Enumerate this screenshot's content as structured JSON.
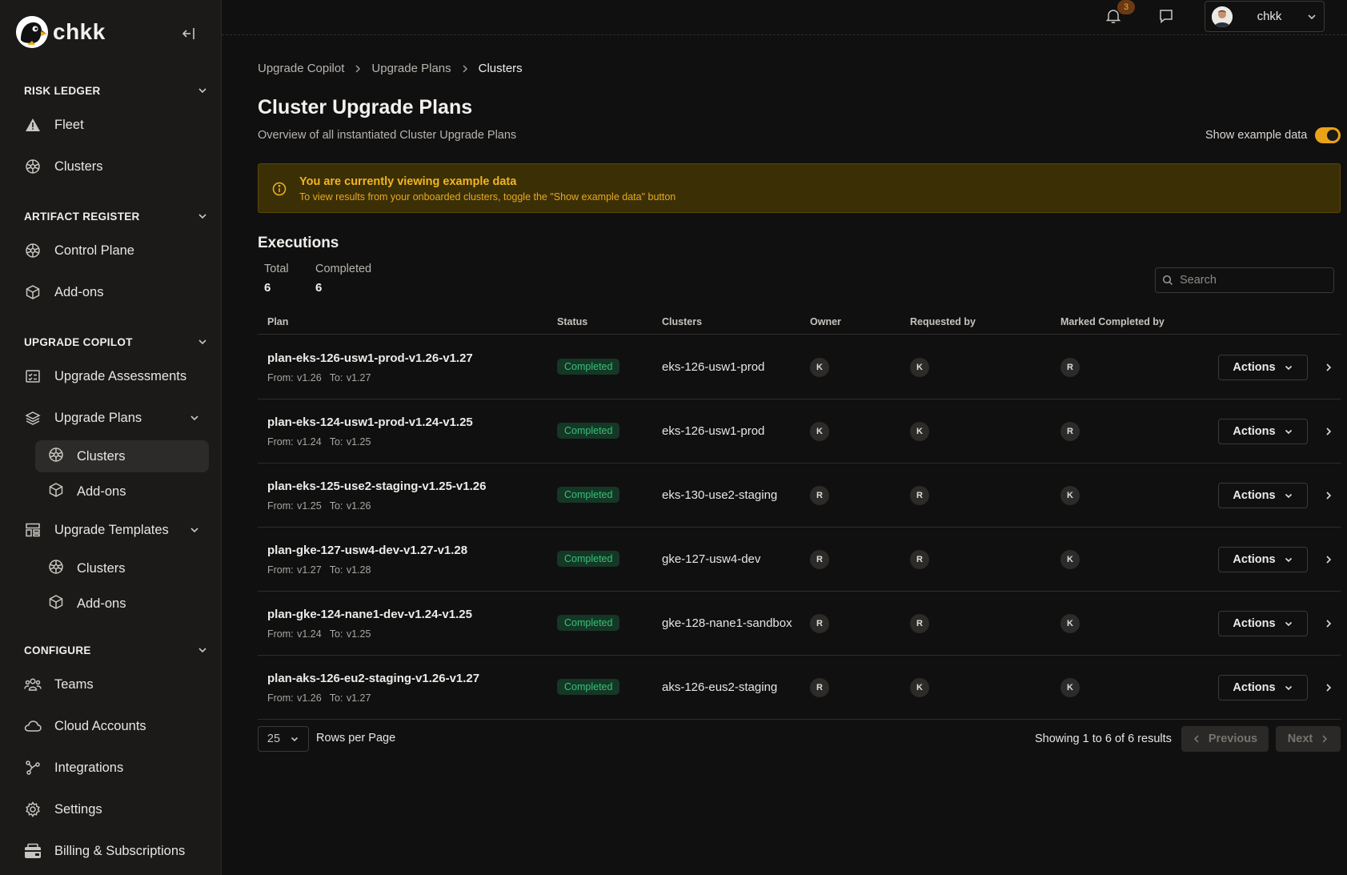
{
  "app": {
    "name": "chkk",
    "notifications_count": "3",
    "user_name": "chkk"
  },
  "sidebar": {
    "sections": [
      {
        "title": "RISK LEDGER",
        "items": [
          "Fleet",
          "Clusters"
        ]
      },
      {
        "title": "ARTIFACT REGISTER",
        "items": [
          "Control Plane",
          "Add-ons"
        ]
      },
      {
        "title": "UPGRADE COPILOT",
        "items": [
          "Upgrade Assessments",
          "Upgrade Plans",
          "Clusters",
          "Add-ons",
          "Upgrade Templates",
          "Clusters",
          "Add-ons"
        ]
      },
      {
        "title": "CONFIGURE",
        "items": [
          "Teams",
          "Cloud Accounts",
          "Integrations",
          "Settings",
          "Billing & Subscriptions"
        ]
      }
    ],
    "active_item": "Clusters"
  },
  "breadcrumb": [
    "Upgrade Copilot",
    "Upgrade Plans",
    "Clusters"
  ],
  "page": {
    "title": "Cluster Upgrade Plans",
    "subtitle": "Overview of all instantiated Cluster Upgrade Plans",
    "toggle_label": "Show example data",
    "toggle_on": true
  },
  "alert": {
    "title": "You are currently viewing example data",
    "body": "To view results from your onboarded clusters, toggle the \"Show example data\" button",
    "color": "#f2b51f"
  },
  "executions": {
    "title": "Executions",
    "total_label": "Total",
    "total_value": "6",
    "completed_label": "Completed",
    "completed_value": "6",
    "search_placeholder": "Search"
  },
  "table": {
    "columns": [
      "Plan",
      "Status",
      "Clusters",
      "Owner",
      "Requested by",
      "Marked Completed by"
    ],
    "rows": [
      {
        "plan": "plan-eks-126-usw1-prod-v1.26-v1.27",
        "from": "From: v1.26",
        "to": "To: v1.27",
        "status": "Completed",
        "cluster": "eks-126-usw1-prod",
        "owner": "K",
        "requested": "K",
        "completed_by": "R",
        "action": "Actions"
      },
      {
        "plan": "plan-eks-124-usw1-prod-v1.24-v1.25",
        "from": "From: v1.24",
        "to": "To: v1.25",
        "status": "Completed",
        "cluster": "eks-126-usw1-prod",
        "owner": "K",
        "requested": "K",
        "completed_by": "R",
        "action": "Actions"
      },
      {
        "plan": "plan-eks-125-use2-staging-v1.25-v1.26",
        "from": "From: v1.25",
        "to": "To: v1.26",
        "status": "Completed",
        "cluster": "eks-130-use2-staging",
        "owner": "R",
        "requested": "R",
        "completed_by": "K",
        "action": "Actions"
      },
      {
        "plan": "plan-gke-127-usw4-dev-v1.27-v1.28",
        "from": "From: v1.27",
        "to": "To: v1.28",
        "status": "Completed",
        "cluster": "gke-127-usw4-dev",
        "owner": "R",
        "requested": "R",
        "completed_by": "K",
        "action": "Actions"
      },
      {
        "plan": "plan-gke-124-nane1-dev-v1.24-v1.25",
        "from": "From: v1.24",
        "to": "To: v1.25",
        "status": "Completed",
        "cluster": "gke-128-nane1-sandbox",
        "owner": "R",
        "requested": "R",
        "completed_by": "K",
        "action": "Actions"
      },
      {
        "plan": "plan-aks-126-eu2-staging-v1.26-v1.27",
        "from": "From: v1.26",
        "to": "To: v1.27",
        "status": "Completed",
        "cluster": "aks-126-eus2-staging",
        "owner": "R",
        "requested": "K",
        "completed_by": "K",
        "action": "Actions"
      }
    ]
  },
  "pagination": {
    "rows_per_page_value": "25",
    "rows_per_page_label": "Rows per Page",
    "results_text": "Showing 1 to 6 of 6 results",
    "previous_label": "Previous",
    "next_label": "Next"
  },
  "colors": {
    "accent": "#e9a21a",
    "status_completed_bg": "#143726",
    "status_completed_text": "#37c07a",
    "alert_bg": "#3b2f06"
  },
  "icons": [
    "alert-triangle-icon",
    "cluster-wheel-icon",
    "cube-icon",
    "checklist-icon",
    "layers-icon",
    "template-grid-icon",
    "teams-icon",
    "cloud-icon",
    "integrations-icon",
    "gear-icon",
    "billing-icon",
    "bell-icon",
    "chat-icon",
    "search-icon",
    "info-icon",
    "chevron-down-icon",
    "chevron-right-icon",
    "collapse-sidebar-icon"
  ]
}
